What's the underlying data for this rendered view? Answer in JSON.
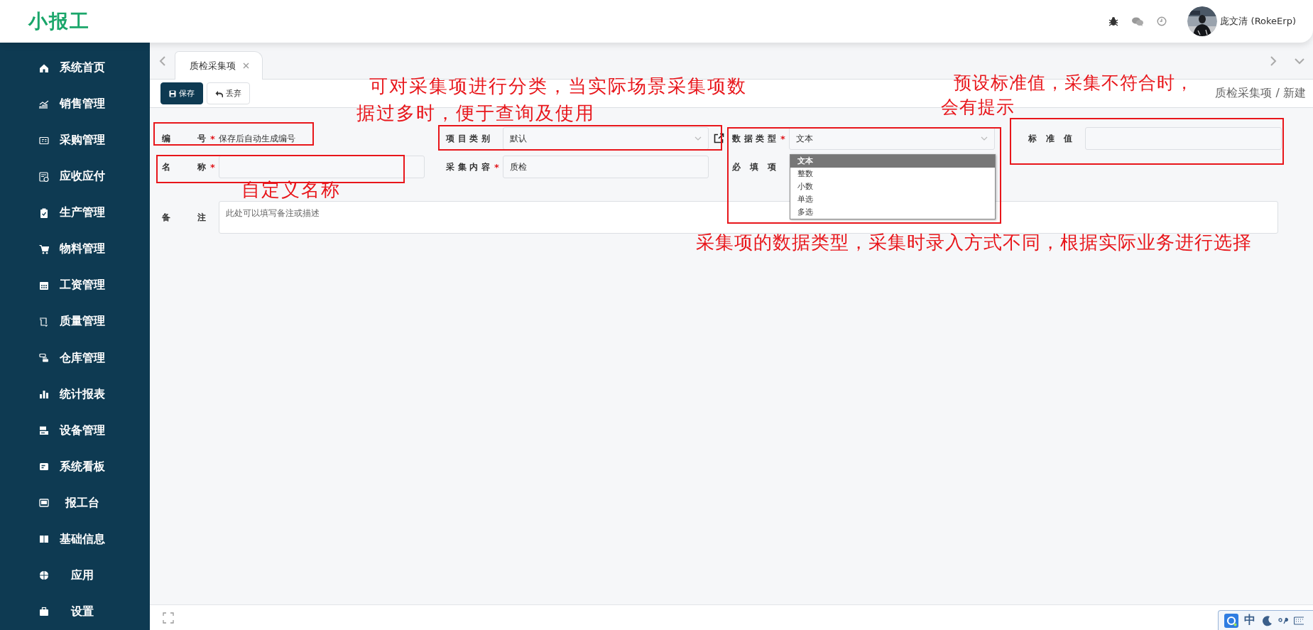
{
  "header": {
    "logo": "小报工",
    "user": {
      "name": "庞文清 (RokeErp)"
    }
  },
  "sidebar": {
    "items": [
      {
        "label": "系统首页"
      },
      {
        "label": "销售管理"
      },
      {
        "label": "采购管理"
      },
      {
        "label": "应收应付"
      },
      {
        "label": "生产管理"
      },
      {
        "label": "物料管理"
      },
      {
        "label": "工资管理"
      },
      {
        "label": "质量管理"
      },
      {
        "label": "仓库管理"
      },
      {
        "label": "统计报表"
      },
      {
        "label": "设备管理"
      },
      {
        "label": "系统看板"
      },
      {
        "label": "报工台"
      },
      {
        "label": "基础信息"
      },
      {
        "label": "应用"
      },
      {
        "label": "设置"
      }
    ]
  },
  "tabs": [
    {
      "label": "质检采集项",
      "selected": true,
      "closable": true
    }
  ],
  "toolbar": {
    "buttons": [
      {
        "label": "保存",
        "kind": "primary"
      },
      {
        "label": "丢弃",
        "kind": "secondary"
      }
    ],
    "breadcrumb": "质检采集项 / 新建"
  },
  "form": {
    "rows": [
      [
        {
          "label": "编号",
          "required_mark": "*",
          "kind": "static",
          "value": "保存后自动生成编号"
        },
        {
          "label": "项目类别",
          "kind": "select",
          "value": "默认",
          "external_link": true
        },
        {
          "label": "数据类型",
          "required_mark": "*",
          "kind": "select",
          "value": "文本",
          "expanded": true,
          "options": [
            {
              "label": "文本",
              "selected": true
            },
            {
              "label": "整数",
              "selected": false
            },
            {
              "label": "小数",
              "selected": false
            },
            {
              "label": "单选",
              "selected": false
            },
            {
              "label": "多选",
              "selected": false
            }
          ]
        },
        {
          "label": "标准值",
          "kind": "input"
        }
      ],
      [
        {
          "label": "名称",
          "required_mark": "*",
          "kind": "input"
        },
        {
          "label": "采集内容",
          "required_mark": "*",
          "kind": "input",
          "value": "质检"
        },
        {
          "label": "必填项",
          "kind": "label"
        }
      ],
      [
        {
          "label": "备注",
          "kind": "textarea",
          "placeholder": "此处可以填写备注或描述"
        }
      ]
    ]
  },
  "annotations": [
    {
      "kind": "note",
      "text": "可对采集项进行分类，当实际场景采集项数据过多时，便于查询及使用"
    },
    {
      "kind": "box"
    },
    {
      "kind": "box"
    },
    {
      "kind": "box"
    },
    {
      "kind": "note",
      "text": "自定义名称"
    },
    {
      "kind": "box"
    },
    {
      "kind": "box"
    },
    {
      "kind": "note",
      "text": "预设标准值，采集不符合时，会有提示"
    },
    {
      "kind": "note",
      "text": "采集项的数据类型，采集时录入方式不同，根据实际业务进行选择"
    }
  ],
  "ime": {
    "mode": "中"
  }
}
